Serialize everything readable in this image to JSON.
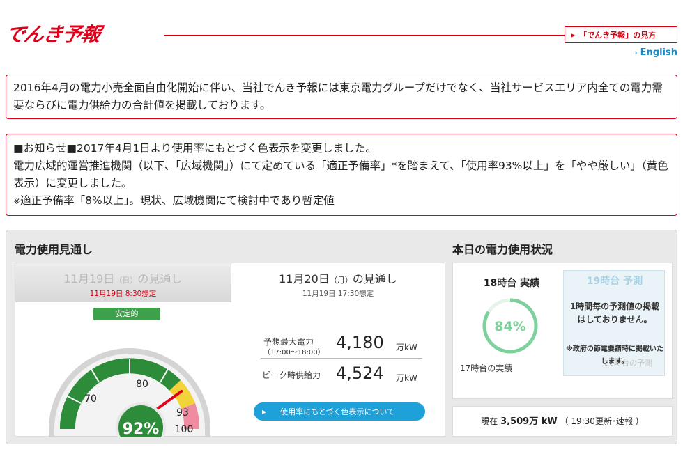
{
  "header": {
    "logo": "でんき予報",
    "howto_label": "「でんき予報」の見方",
    "english_label": "English"
  },
  "notices": {
    "liberalization": "2016年4月の電力小売全面自由化開始に伴い、当社でんき予報には東京電力グループだけでなく、当社サービスエリア内全ての電力需要ならびに電力供給力の合計値を掲載しております。",
    "announcement_line1": "■お知らせ■2017年4月1日より使用率にもとづく色表示を変更しました。",
    "announcement_line2": "電力広域的運営推進機関（以下、「広域機関」）にて定めている「適正予備率」*を踏まえて、「使用率93%以上」を「やや厳しい」（黄色表示）に変更しました。",
    "announcement_note_mark": "※",
    "announcement_note": "適正予備率「8%以上」。現状、広域機関にて検討中であり暫定値"
  },
  "forecast": {
    "section_title": "電力使用見通し",
    "prev_tab": {
      "date": "11月19日",
      "weekday": "（日）",
      "suffix": "の見通し",
      "assumed": "11月19日 8:30想定"
    },
    "current_tab": {
      "date": "11月20日",
      "weekday": "（月）",
      "suffix": "の見通し",
      "assumed": "11月19日 17:30想定"
    },
    "status_label": "安定的",
    "gauge": {
      "value_label": "92%",
      "value": 92,
      "tick_labels": [
        "70",
        "80",
        "93",
        "100"
      ]
    },
    "peak_demand_label": "予想最大電力",
    "peak_demand_time": "（17:00～18:00）",
    "peak_demand_value": "4,180",
    "peak_demand_unit": "万kW",
    "peak_supply_label": "ピーク時供給力",
    "peak_supply_value": "4,524",
    "peak_supply_unit": "万kW",
    "color_info_label": "使用率にもとづく色表示について"
  },
  "today": {
    "section_title": "本日の電力使用状況",
    "actual_title": "18時台 実績",
    "actual_value": "84%",
    "actual_fraction": 0.84,
    "actual_note": "17時台の実績",
    "pred_title": "19時台 予測",
    "pred_message": "1時間毎の予測値の掲載はしておりません。",
    "pred_note": "※政府の節電要請時に掲載いたします。",
    "pred_ghost": "20時台の予測",
    "current_prefix": "現在",
    "current_value": "3,509万 kW",
    "current_update": "（ 19:30更新･速報 ）"
  },
  "colors": {
    "brand_red": "#e0001a",
    "stable_green": "#3da04a",
    "caution_yellow": "#f0d43a",
    "alert_pink": "#f08ca0",
    "link_blue": "#1a8ac8",
    "ring_green": "#7ed09c"
  }
}
